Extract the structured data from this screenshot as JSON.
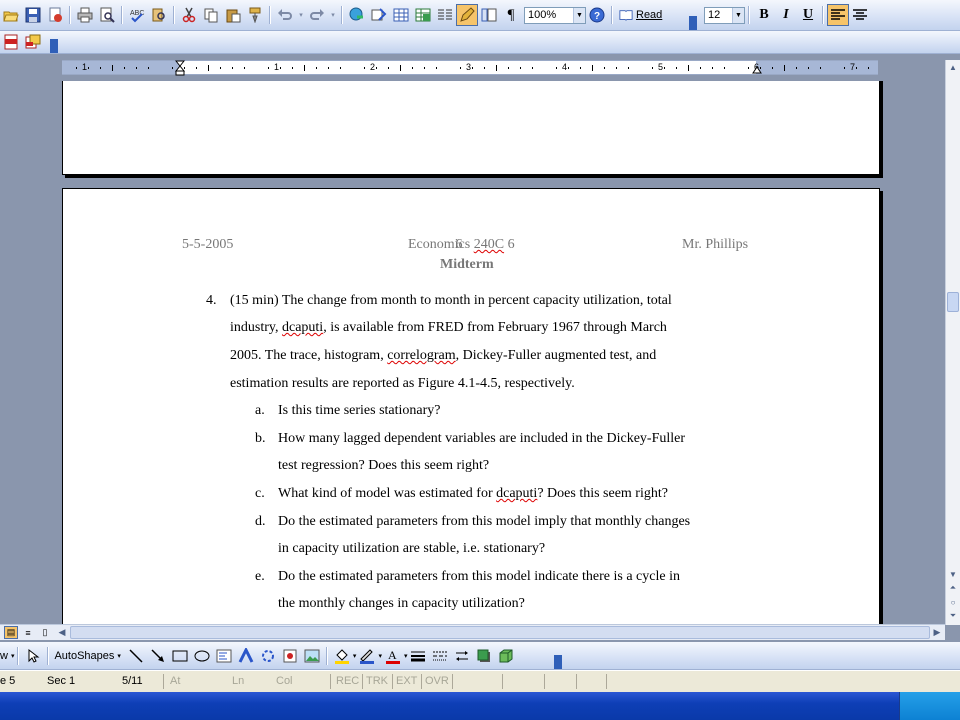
{
  "toolbar": {
    "zoom": "100%",
    "read_label": "Read",
    "font_size": "12",
    "bold": "B",
    "italic": "I",
    "underline": "U"
  },
  "drawing": {
    "autoshapes_label": "AutoShapes",
    "draw_label": "w"
  },
  "ruler": {
    "numbers": [
      "1",
      "1",
      "2",
      "3",
      "4",
      "5",
      "6",
      "7"
    ]
  },
  "document": {
    "header": {
      "date": "5-5-2005",
      "course_prefix": "Economi",
      "course_cs": "cs",
      "course_num": "240C",
      "page_num": "6",
      "page_suffix": "6",
      "instructor": "Mr. Phillips",
      "title": "Midterm"
    },
    "question": {
      "number": "4.",
      "lines": [
        [
          "(15 min) The change from month to month in percent capacity utilization, total",
          "",
          ""
        ],
        [
          "industry, ",
          "dcaputi",
          ", is available from FRED from February 1967 through March"
        ],
        [
          "2005. The trace, histogram, ",
          "correlogram",
          ", Dickey-Fuller augmented test, and"
        ],
        [
          "estimation results are reported as Figure 4.1-4.5, respectively.",
          "",
          ""
        ]
      ],
      "items": [
        {
          "label": "a.",
          "lines": [
            [
              "Is this time series stationary?",
              "",
              ""
            ]
          ]
        },
        {
          "label": "b.",
          "lines": [
            [
              "How many lagged dependent variables are included in the Dickey-Fuller",
              "",
              ""
            ],
            [
              "test regression? Does this seem right?",
              "",
              ""
            ]
          ]
        },
        {
          "label": "c.",
          "lines": [
            [
              "What kind of model was estimated for ",
              "dcaputi",
              "? Does this seem right?"
            ]
          ]
        },
        {
          "label": "d.",
          "lines": [
            [
              "Do the estimated parameters from this model imply that monthly changes",
              "",
              ""
            ],
            [
              "in capacity utilization are stable, i.e. stationary?",
              "",
              ""
            ]
          ]
        },
        {
          "label": "e.",
          "lines": [
            [
              "Do the estimated parameters from this model indicate there is a cycle in",
              "",
              ""
            ],
            [
              "the monthly changes in capacity utilization?",
              "",
              ""
            ]
          ]
        }
      ]
    }
  },
  "status": {
    "page": "e  5",
    "sec": "Sec  1",
    "pages": "5/11",
    "at": "At",
    "ln": "Ln",
    "col": "Col",
    "rec": "REC",
    "trk": "TRK",
    "ext": "EXT",
    "ovr": "OVR"
  },
  "colors": {
    "workspace": "#8a96ad",
    "toolbar": "#d6e1f5",
    "header_text": "#777777",
    "squiggle": "#dd0000"
  }
}
